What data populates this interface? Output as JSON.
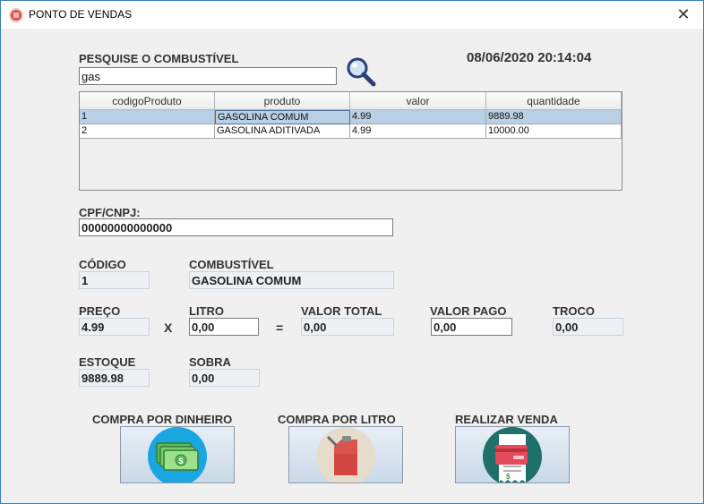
{
  "window": {
    "title": "PONTO DE VENDAS",
    "close_glyph": "✕"
  },
  "search": {
    "label": "PESQUISE O COMBUSTÍVEL",
    "value": "gas",
    "icon": "search-icon"
  },
  "datetime": "08/06/2020 20:14:04",
  "table": {
    "columns": [
      "codigoProduto",
      "produto",
      "valor",
      "quantidade"
    ],
    "rows": [
      {
        "codigoProduto": "1",
        "produto": "GASOLINA COMUM",
        "valor": "4.99",
        "quantidade": "9889.98"
      },
      {
        "codigoProduto": "2",
        "produto": "GASOLINA ADITIVADA",
        "valor": "4.99",
        "quantidade": "10000.00"
      }
    ]
  },
  "cpf": {
    "label": "CPF/CNPJ:",
    "value": "00000000000000"
  },
  "codigo": {
    "label": "CÓDIGO",
    "value": "1"
  },
  "combustivel": {
    "label": "COMBUSTÍVEL",
    "value": "GASOLINA COMUM"
  },
  "preco": {
    "label": "PREÇO",
    "value": "4.99"
  },
  "mult_sign": "X",
  "litro": {
    "label": "LITRO",
    "value": "0,00"
  },
  "equals_sign": "=",
  "valor_total": {
    "label": "VALOR TOTAL",
    "value": "0,00"
  },
  "valor_pago": {
    "label": "VALOR PAGO",
    "value": "0,00"
  },
  "troco": {
    "label": "TROCO",
    "value": "0,00"
  },
  "estoque": {
    "label": "ESTOQUE",
    "value": "9889.98"
  },
  "sobra": {
    "label": "SOBRA",
    "value": "0,00"
  },
  "buttons": {
    "dinheiro": {
      "label": "COMPRA POR DINHEIRO",
      "icon": "money-icon"
    },
    "litro": {
      "label": "COMPRA POR LITRO",
      "icon": "fuel-can-icon"
    },
    "venda": {
      "label": "REALIZAR VENDA",
      "icon": "credit-card-receipt-icon"
    }
  },
  "colors": {
    "selection": "#b8cfe5",
    "readonly_bg": "#eef0f3",
    "window_bg": "#f0f0f0"
  }
}
